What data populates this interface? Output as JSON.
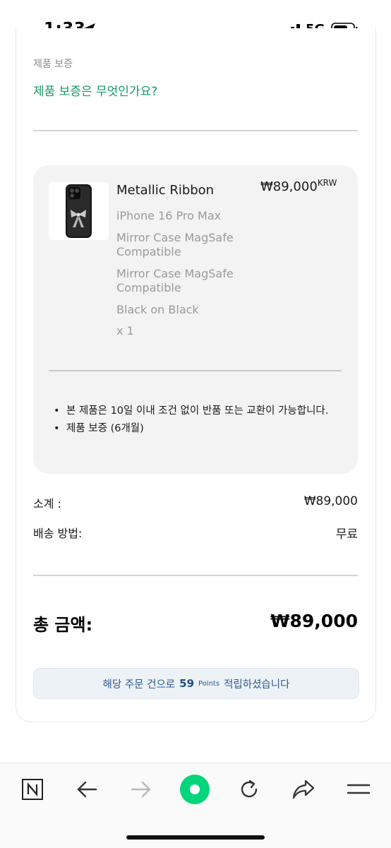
{
  "status_bar": {
    "time": "1:33",
    "network": "5G"
  },
  "warranty": {
    "heading": "제품 보증",
    "link": "제품 보증은 무엇인가요?"
  },
  "product": {
    "name": "Metallic Ribbon",
    "price": "₩89,000",
    "currency": "KRW",
    "options": [
      "iPhone 16 Pro Max",
      "Mirror Case MagSafe Compatible",
      "Mirror Case MagSafe Compatible",
      "Black on Black",
      "x 1"
    ]
  },
  "notes": [
    "본 제품은 10일 이내 조건 없이 반품 또는 교환이 가능합니다.",
    "제품 보증 (6개월)"
  ],
  "summary": {
    "subtotal_label": "소계 :",
    "subtotal_value": "₩89,000",
    "shipping_label": "배송 방법:",
    "shipping_value": "무료",
    "total_label": "총 금액:",
    "total_value": "₩89,000"
  },
  "points_banner": {
    "prefix": "해당 주문 건으로",
    "points": "59",
    "unit": "Points",
    "suffix": "적립하셨습니다"
  },
  "toolbar_icons": [
    "naver-icon",
    "back-arrow-icon",
    "forward-arrow-icon",
    "green-dot-icon",
    "reload-icon",
    "share-icon",
    "menu-icon"
  ],
  "colors": {
    "accent_green": "#159a64",
    "points_blue": "#2c5a8d",
    "naver_green": "#03d67a"
  }
}
